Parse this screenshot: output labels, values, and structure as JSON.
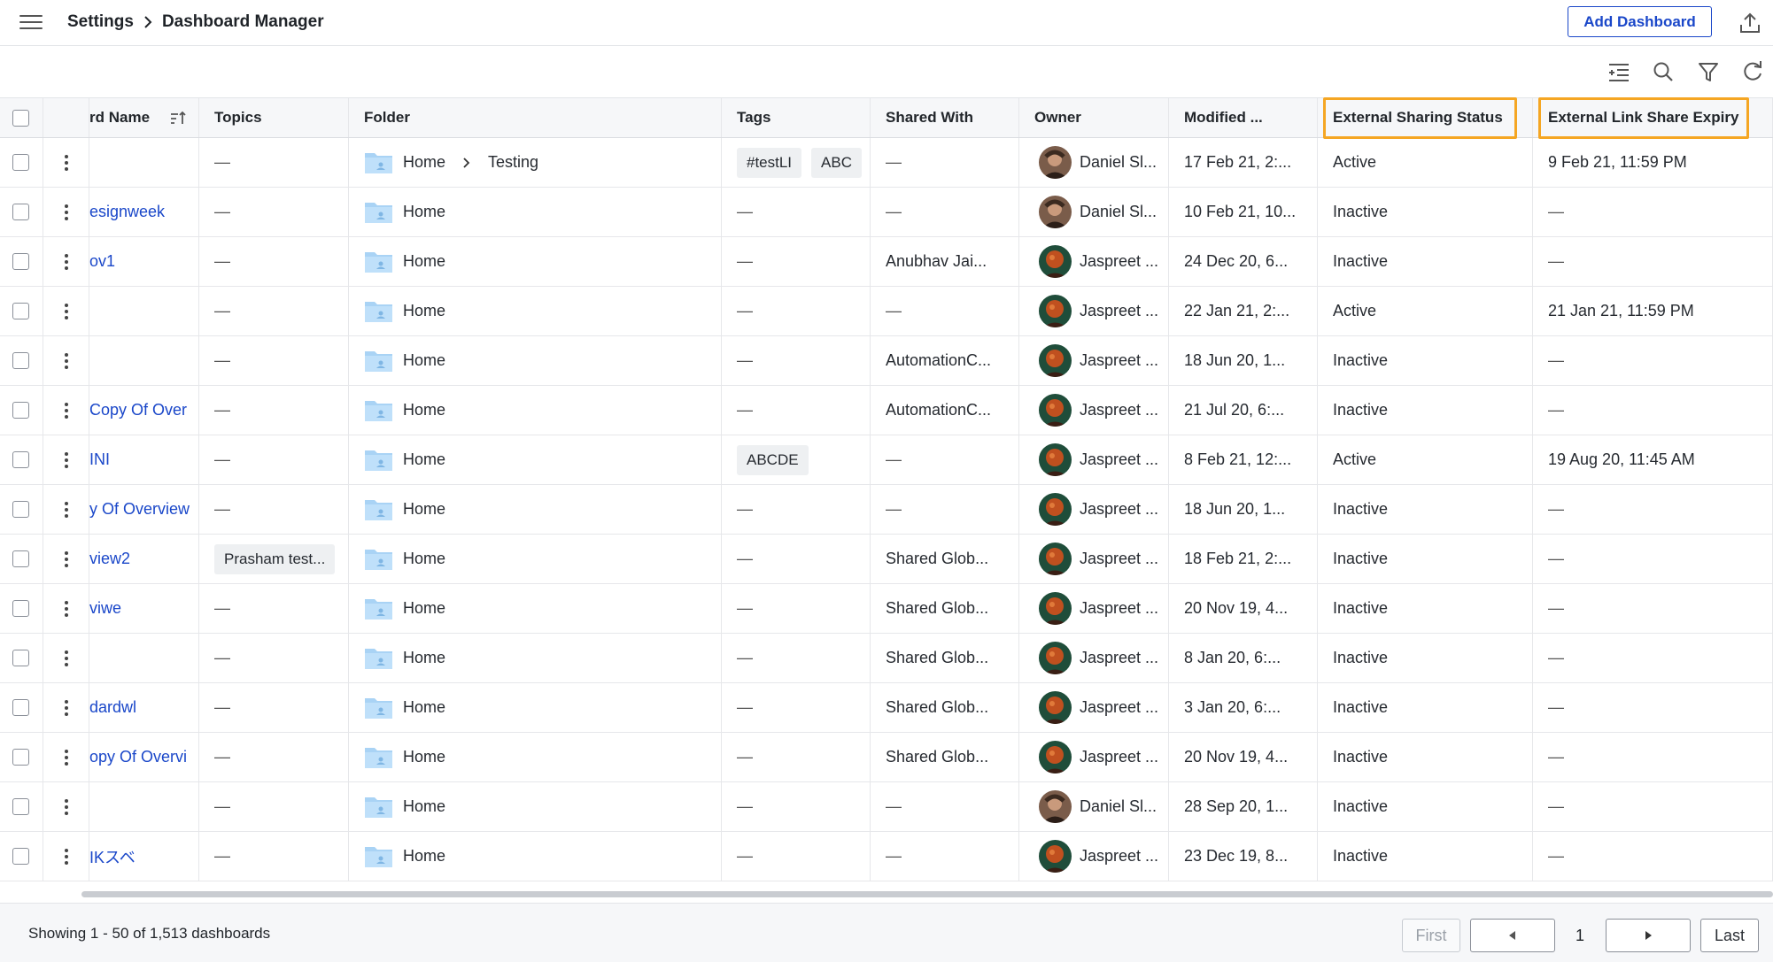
{
  "header": {
    "breadcrumb": [
      "Settings",
      "Dashboard Manager"
    ],
    "add_dashboard_label": "Add Dashboard"
  },
  "colors": {
    "accent": "#1a47c9",
    "highlight": "#f5a623"
  },
  "table": {
    "columns": [
      {
        "key": "name",
        "label": "rd Name"
      },
      {
        "key": "topics",
        "label": "Topics"
      },
      {
        "key": "folder",
        "label": "Folder"
      },
      {
        "key": "tags",
        "label": "Tags"
      },
      {
        "key": "shared",
        "label": "Shared With"
      },
      {
        "key": "owner",
        "label": "Owner"
      },
      {
        "key": "modified",
        "label": "Modified ..."
      },
      {
        "key": "ext_status",
        "label": "External Sharing Status"
      },
      {
        "key": "ext_expiry",
        "label": "External Link Share Expiry"
      }
    ],
    "rows": [
      {
        "name": "",
        "topics": "—",
        "folder": [
          "Home",
          "Testing"
        ],
        "tags": [
          "#testLI",
          "ABC"
        ],
        "shared": "—",
        "owner": "Daniel Sl...",
        "modified": "17 Feb 21, 2:...",
        "ext_status": "Active",
        "ext_expiry": "9 Feb 21, 11:59 PM"
      },
      {
        "name": "esignweek",
        "topics": "—",
        "folder": [
          "Home"
        ],
        "tags": [],
        "shared": "—",
        "owner": "Daniel Sl...",
        "modified": "10 Feb 21, 10...",
        "ext_status": "Inactive",
        "ext_expiry": "—"
      },
      {
        "name": "ov1",
        "topics": "—",
        "folder": [
          "Home"
        ],
        "tags": [],
        "shared": "Anubhav Jai...",
        "owner": "Jaspreet ...",
        "modified": "24 Dec 20, 6...",
        "ext_status": "Inactive",
        "ext_expiry": "—"
      },
      {
        "name": "",
        "topics": "—",
        "folder": [
          "Home"
        ],
        "tags": [],
        "shared": "—",
        "owner": "Jaspreet ...",
        "modified": "22 Jan 21, 2:...",
        "ext_status": "Active",
        "ext_expiry": "21 Jan 21, 11:59 PM"
      },
      {
        "name": "",
        "topics": "—",
        "folder": [
          "Home"
        ],
        "tags": [],
        "shared": "AutomationC...",
        "owner": "Jaspreet ...",
        "modified": "18 Jun 20, 1...",
        "ext_status": "Inactive",
        "ext_expiry": "—"
      },
      {
        "name": "Copy Of Over",
        "topics": "—",
        "folder": [
          "Home"
        ],
        "tags": [],
        "shared": "AutomationC...",
        "owner": "Jaspreet ...",
        "modified": "21 Jul 20, 6:...",
        "ext_status": "Inactive",
        "ext_expiry": "—"
      },
      {
        "name": "INI",
        "topics": "—",
        "folder": [
          "Home"
        ],
        "tags": [
          "ABCDE"
        ],
        "shared": "—",
        "owner": "Jaspreet ...",
        "modified": "8 Feb 21, 12:...",
        "ext_status": "Active",
        "ext_expiry": "19 Aug 20, 11:45 AM"
      },
      {
        "name": "y Of Overview",
        "topics": "—",
        "folder": [
          "Home"
        ],
        "tags": [],
        "shared": "—",
        "owner": "Jaspreet ...",
        "modified": "18 Jun 20, 1...",
        "ext_status": "Inactive",
        "ext_expiry": "—"
      },
      {
        "name": "view2",
        "topics": "Prasham test...",
        "folder": [
          "Home"
        ],
        "tags": [],
        "shared": "Shared Glob...",
        "owner": "Jaspreet ...",
        "modified": "18 Feb 21, 2:...",
        "ext_status": "Inactive",
        "ext_expiry": "—"
      },
      {
        "name": "viwe",
        "topics": "—",
        "folder": [
          "Home"
        ],
        "tags": [],
        "shared": "Shared Glob...",
        "owner": "Jaspreet ...",
        "modified": "20 Nov 19, 4...",
        "ext_status": "Inactive",
        "ext_expiry": "—"
      },
      {
        "name": "",
        "topics": "—",
        "folder": [
          "Home"
        ],
        "tags": [],
        "shared": "Shared Glob...",
        "owner": "Jaspreet ...",
        "modified": "8 Jan 20, 6:...",
        "ext_status": "Inactive",
        "ext_expiry": "—"
      },
      {
        "name": "dardwl",
        "topics": "—",
        "folder": [
          "Home"
        ],
        "tags": [],
        "shared": "Shared Glob...",
        "owner": "Jaspreet ...",
        "modified": "3 Jan 20, 6:...",
        "ext_status": "Inactive",
        "ext_expiry": "—"
      },
      {
        "name": "opy Of Overvi",
        "topics": "—",
        "folder": [
          "Home"
        ],
        "tags": [],
        "shared": "Shared Glob...",
        "owner": "Jaspreet ...",
        "modified": "20 Nov 19, 4...",
        "ext_status": "Inactive",
        "ext_expiry": "—"
      },
      {
        "name": "",
        "topics": "—",
        "folder": [
          "Home"
        ],
        "tags": [],
        "shared": "—",
        "owner": "Daniel Sl...",
        "modified": "28 Sep 20, 1...",
        "ext_status": "Inactive",
        "ext_expiry": "—"
      },
      {
        "name": "IKスベ",
        "topics": "—",
        "folder": [
          "Home"
        ],
        "tags": [],
        "shared": "—",
        "owner": "Jaspreet ...",
        "modified": "23 Dec 19, 8...",
        "ext_status": "Inactive",
        "ext_expiry": "—"
      }
    ]
  },
  "footer": {
    "showing": "Showing 1 - 50 of 1,513 dashboards",
    "first": "First",
    "page": "1",
    "last": "Last"
  }
}
